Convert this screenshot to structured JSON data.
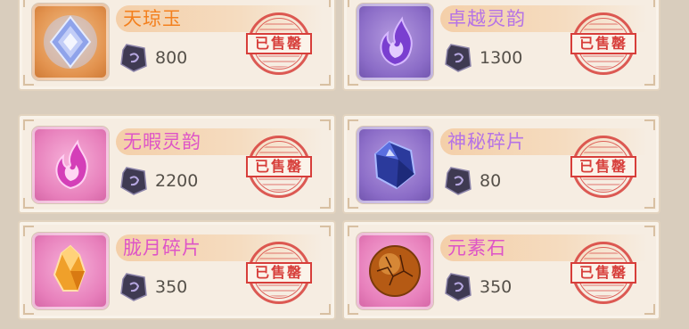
{
  "shop": {
    "items": [
      {
        "name": "天琼玉",
        "price": "800",
        "sold_label": "已售罄",
        "tier": "orange",
        "icon": "diamond-crystal-icon"
      },
      {
        "name": "卓越灵韵",
        "price": "1300",
        "sold_label": "已售罄",
        "tier": "purple",
        "icon": "purple-flame-icon"
      },
      {
        "name": "无暇灵韵",
        "price": "2200",
        "sold_label": "已售罄",
        "tier": "pink",
        "icon": "pink-flame-icon"
      },
      {
        "name": "神秘碎片",
        "price": "80",
        "sold_label": "已售罄",
        "tier": "purple",
        "icon": "blue-gem-icon"
      },
      {
        "name": "胧月碎片",
        "price": "350",
        "sold_label": "已售罄",
        "tier": "pink",
        "icon": "amber-crystal-icon"
      },
      {
        "name": "元素石",
        "price": "350",
        "sold_label": "已售罄",
        "tier": "pink",
        "icon": "element-orb-icon"
      }
    ],
    "currency_icon": "dark-gem-currency-icon"
  },
  "colors": {
    "stamp_red": "#d73e3a",
    "name_orange": "#f3801e",
    "name_purple": "#b573e6",
    "name_pink": "#de54c7"
  }
}
